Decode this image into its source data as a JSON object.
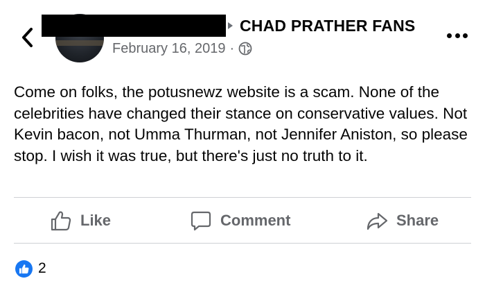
{
  "header": {
    "group_name": "CHAD PRATHER FANS",
    "date": "February 16, 2019",
    "separator": "·",
    "privacy_icon": "globe-icon",
    "back_icon": "chevron-left-icon",
    "more_icon": "more-dots-icon"
  },
  "post": {
    "text": "Come on folks, the potusnewz website is a scam. None of the celebrities have changed their stance on conservative values. Not Kevin bacon, not Umma Thurman, not Jennifer Aniston, so please stop. I wish it was true, but there's just no truth to it."
  },
  "actions": {
    "like_label": "Like",
    "comment_label": "Comment",
    "share_label": "Share"
  },
  "reactions": {
    "count": "2",
    "icon": "like-reaction-icon",
    "color": "#1877f2"
  },
  "colors": {
    "secondary_text": "#65676b",
    "divider": "#ced0d4",
    "accent": "#1877f2"
  }
}
